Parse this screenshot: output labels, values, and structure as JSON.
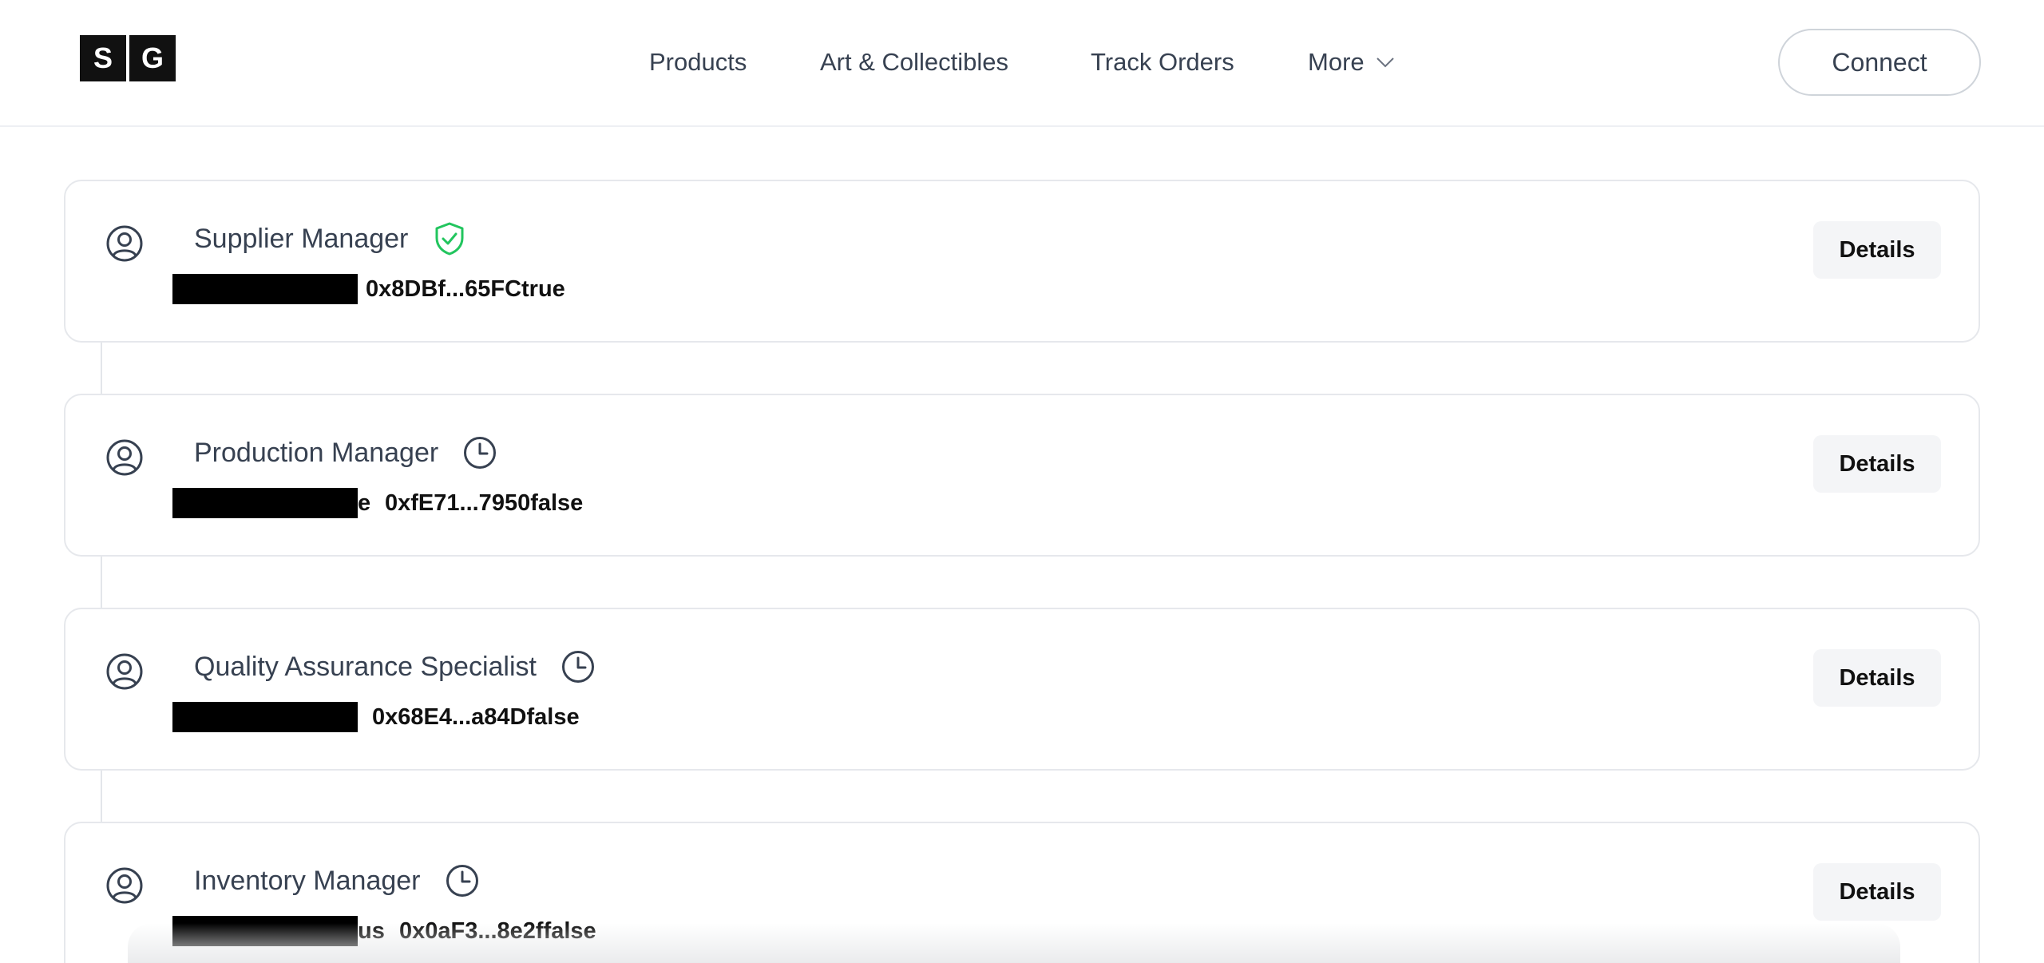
{
  "header": {
    "logo": {
      "letters": [
        "S",
        "G"
      ]
    },
    "nav": [
      {
        "label": "Products"
      },
      {
        "label": "Art & Collectibles"
      },
      {
        "label": "Track Orders"
      },
      {
        "label": "More",
        "icon": "chevron-down-icon"
      }
    ],
    "connect_label": "Connect"
  },
  "roles": [
    {
      "title": "Supplier Manager",
      "status_icon": "verified-shield-icon",
      "status": "verified",
      "redacted_tail": "",
      "address": "0x8DBf...65FCtrue",
      "details_label": "Details"
    },
    {
      "title": "Production Manager",
      "status_icon": "clock-icon",
      "status": "pending",
      "redacted_tail": "e",
      "address": "0xfE71...7950false",
      "details_label": "Details"
    },
    {
      "title": "Quality Assurance Specialist",
      "status_icon": "clock-icon",
      "status": "pending",
      "redacted_tail": "",
      "address": "0x68E4...a84Dfalse",
      "details_label": "Details"
    },
    {
      "title": "Inventory Manager",
      "status_icon": "clock-icon",
      "status": "pending",
      "redacted_tail": "us",
      "address": "0x0aF3...8e2ffalse",
      "details_label": "Details"
    }
  ],
  "colors": {
    "verified": "#22c55e",
    "pending_icon": "#374151",
    "border": "#e6e8ec",
    "button_bg": "#f4f5f7"
  }
}
